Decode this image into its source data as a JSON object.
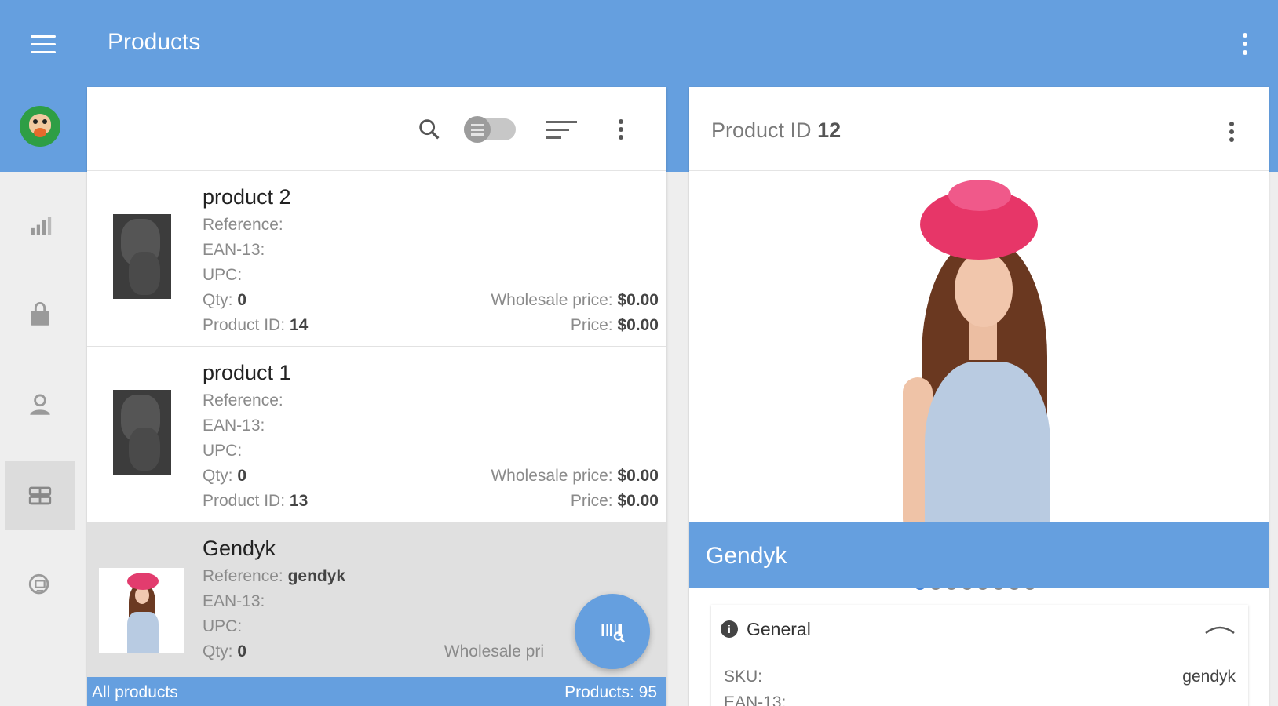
{
  "header": {
    "title": "Products"
  },
  "toolbar": {
    "search_icon": "search-icon",
    "toggle_icon": "view-toggle",
    "sort_icon": "sort-icon",
    "more_icon": "more-vert-icon"
  },
  "nav": [
    {
      "name": "stats",
      "icon": "bar-chart-icon"
    },
    {
      "name": "orders",
      "icon": "shopping-bag-icon"
    },
    {
      "name": "customers",
      "icon": "person-icon"
    },
    {
      "name": "products",
      "icon": "products-icon",
      "active": true
    },
    {
      "name": "catalog",
      "icon": "catalog-icon"
    }
  ],
  "products": [
    {
      "name": "product 2",
      "reference_label": "Reference:",
      "reference_value": "",
      "ean_label": "EAN-13:",
      "upc_label": "UPC:",
      "qty_label": "Qty:",
      "qty_value": "0",
      "id_label": "Product ID:",
      "id_value": "14",
      "wholesale_label": "Wholesale price:",
      "wholesale_value": "$0.00",
      "price_label": "Price:",
      "price_value": "$0.00"
    },
    {
      "name": "product 1",
      "reference_label": "Reference:",
      "reference_value": "",
      "ean_label": "EAN-13:",
      "upc_label": "UPC:",
      "qty_label": "Qty:",
      "qty_value": "0",
      "id_label": "Product ID:",
      "id_value": "13",
      "wholesale_label": "Wholesale price:",
      "wholesale_value": "$0.00",
      "price_label": "Price:",
      "price_value": "$0.00"
    },
    {
      "name": "Gendyk",
      "reference_label": "Reference:",
      "reference_value": "gendyk",
      "ean_label": "EAN-13:",
      "upc_label": "UPC:",
      "qty_label": "Qty:",
      "qty_value": "0",
      "wholesale_label": "Wholesale pri"
    }
  ],
  "footer": {
    "left": "All products",
    "right": "Products: 95"
  },
  "detail": {
    "title_label": "Product ID",
    "title_value": "12",
    "gallery_total": 8,
    "gallery_active": 1,
    "name": "Gendyk",
    "general_title": "General",
    "sku_label": "SKU:",
    "sku_value": "gendyk",
    "ean_label": "EAN-13:"
  },
  "colors": {
    "primary": "#659fdf",
    "selected_row": "#e0e0e0",
    "active_dot": "#4a86d6"
  }
}
